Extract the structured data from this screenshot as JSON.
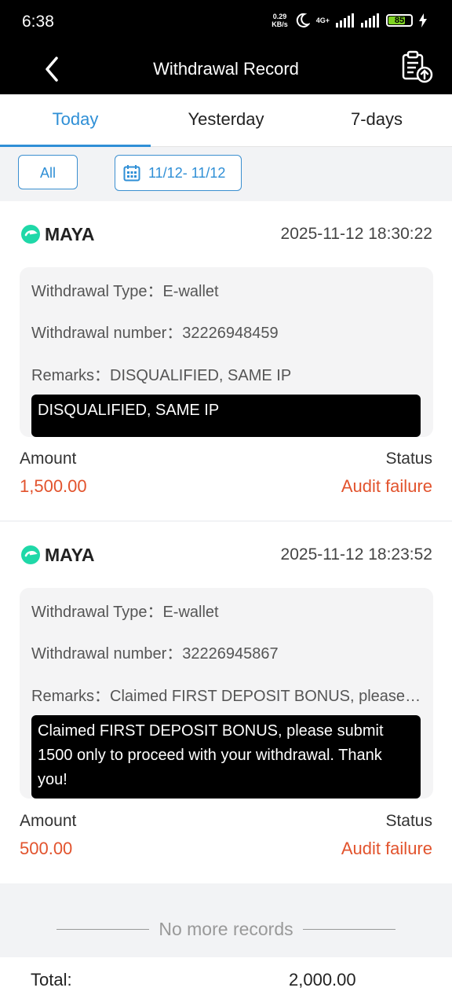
{
  "status_bar": {
    "time": "6:38",
    "net_speed_value": "0.29",
    "net_speed_unit": "KB/s",
    "network": "4G+",
    "battery": "85"
  },
  "navbar": {
    "title": "Withdrawal Record"
  },
  "tabs": [
    {
      "label": "Today",
      "active": true
    },
    {
      "label": "Yesterday",
      "active": false
    },
    {
      "label": "7-days",
      "active": false
    }
  ],
  "filters": {
    "all_label": "All",
    "date_range": "11/12- 11/12"
  },
  "records": [
    {
      "brand": "MAYA",
      "datetime": "2025-11-12 18:30:22",
      "type_line": "Withdrawal Type：E-wallet",
      "number_line": "Withdrawal number：32226948459",
      "remarks_line": "Remarks：DISQUALIFIED, SAME IP",
      "tooltip": "DISQUALIFIED, SAME IP",
      "amount_label": "Amount",
      "amount": "1,500.00",
      "status_label": "Status",
      "status": "Audit failure"
    },
    {
      "brand": "MAYA",
      "datetime": "2025-11-12 18:23:52",
      "type_line": "Withdrawal Type：E-wallet",
      "number_line": "Withdrawal number：32226945867",
      "remarks_line": "Remarks：Claimed FIRST DEPOSIT BONUS, please submit 1500 only to proceed with your withdrawal. Thank you!",
      "tooltip": "Claimed FIRST DEPOSIT BONUS, please submit 1500 only to proceed with your withdrawal. Thank you!",
      "amount_label": "Amount",
      "amount": "500.00",
      "status_label": "Status",
      "status": "Audit failure"
    }
  ],
  "footer": {
    "no_more": "No more records",
    "total_label": "Total:",
    "total_value": "2,000.00"
  },
  "colors": {
    "accent": "#2f8fd6",
    "error": "#e2532d",
    "brand_green": "#1fd8a8"
  }
}
